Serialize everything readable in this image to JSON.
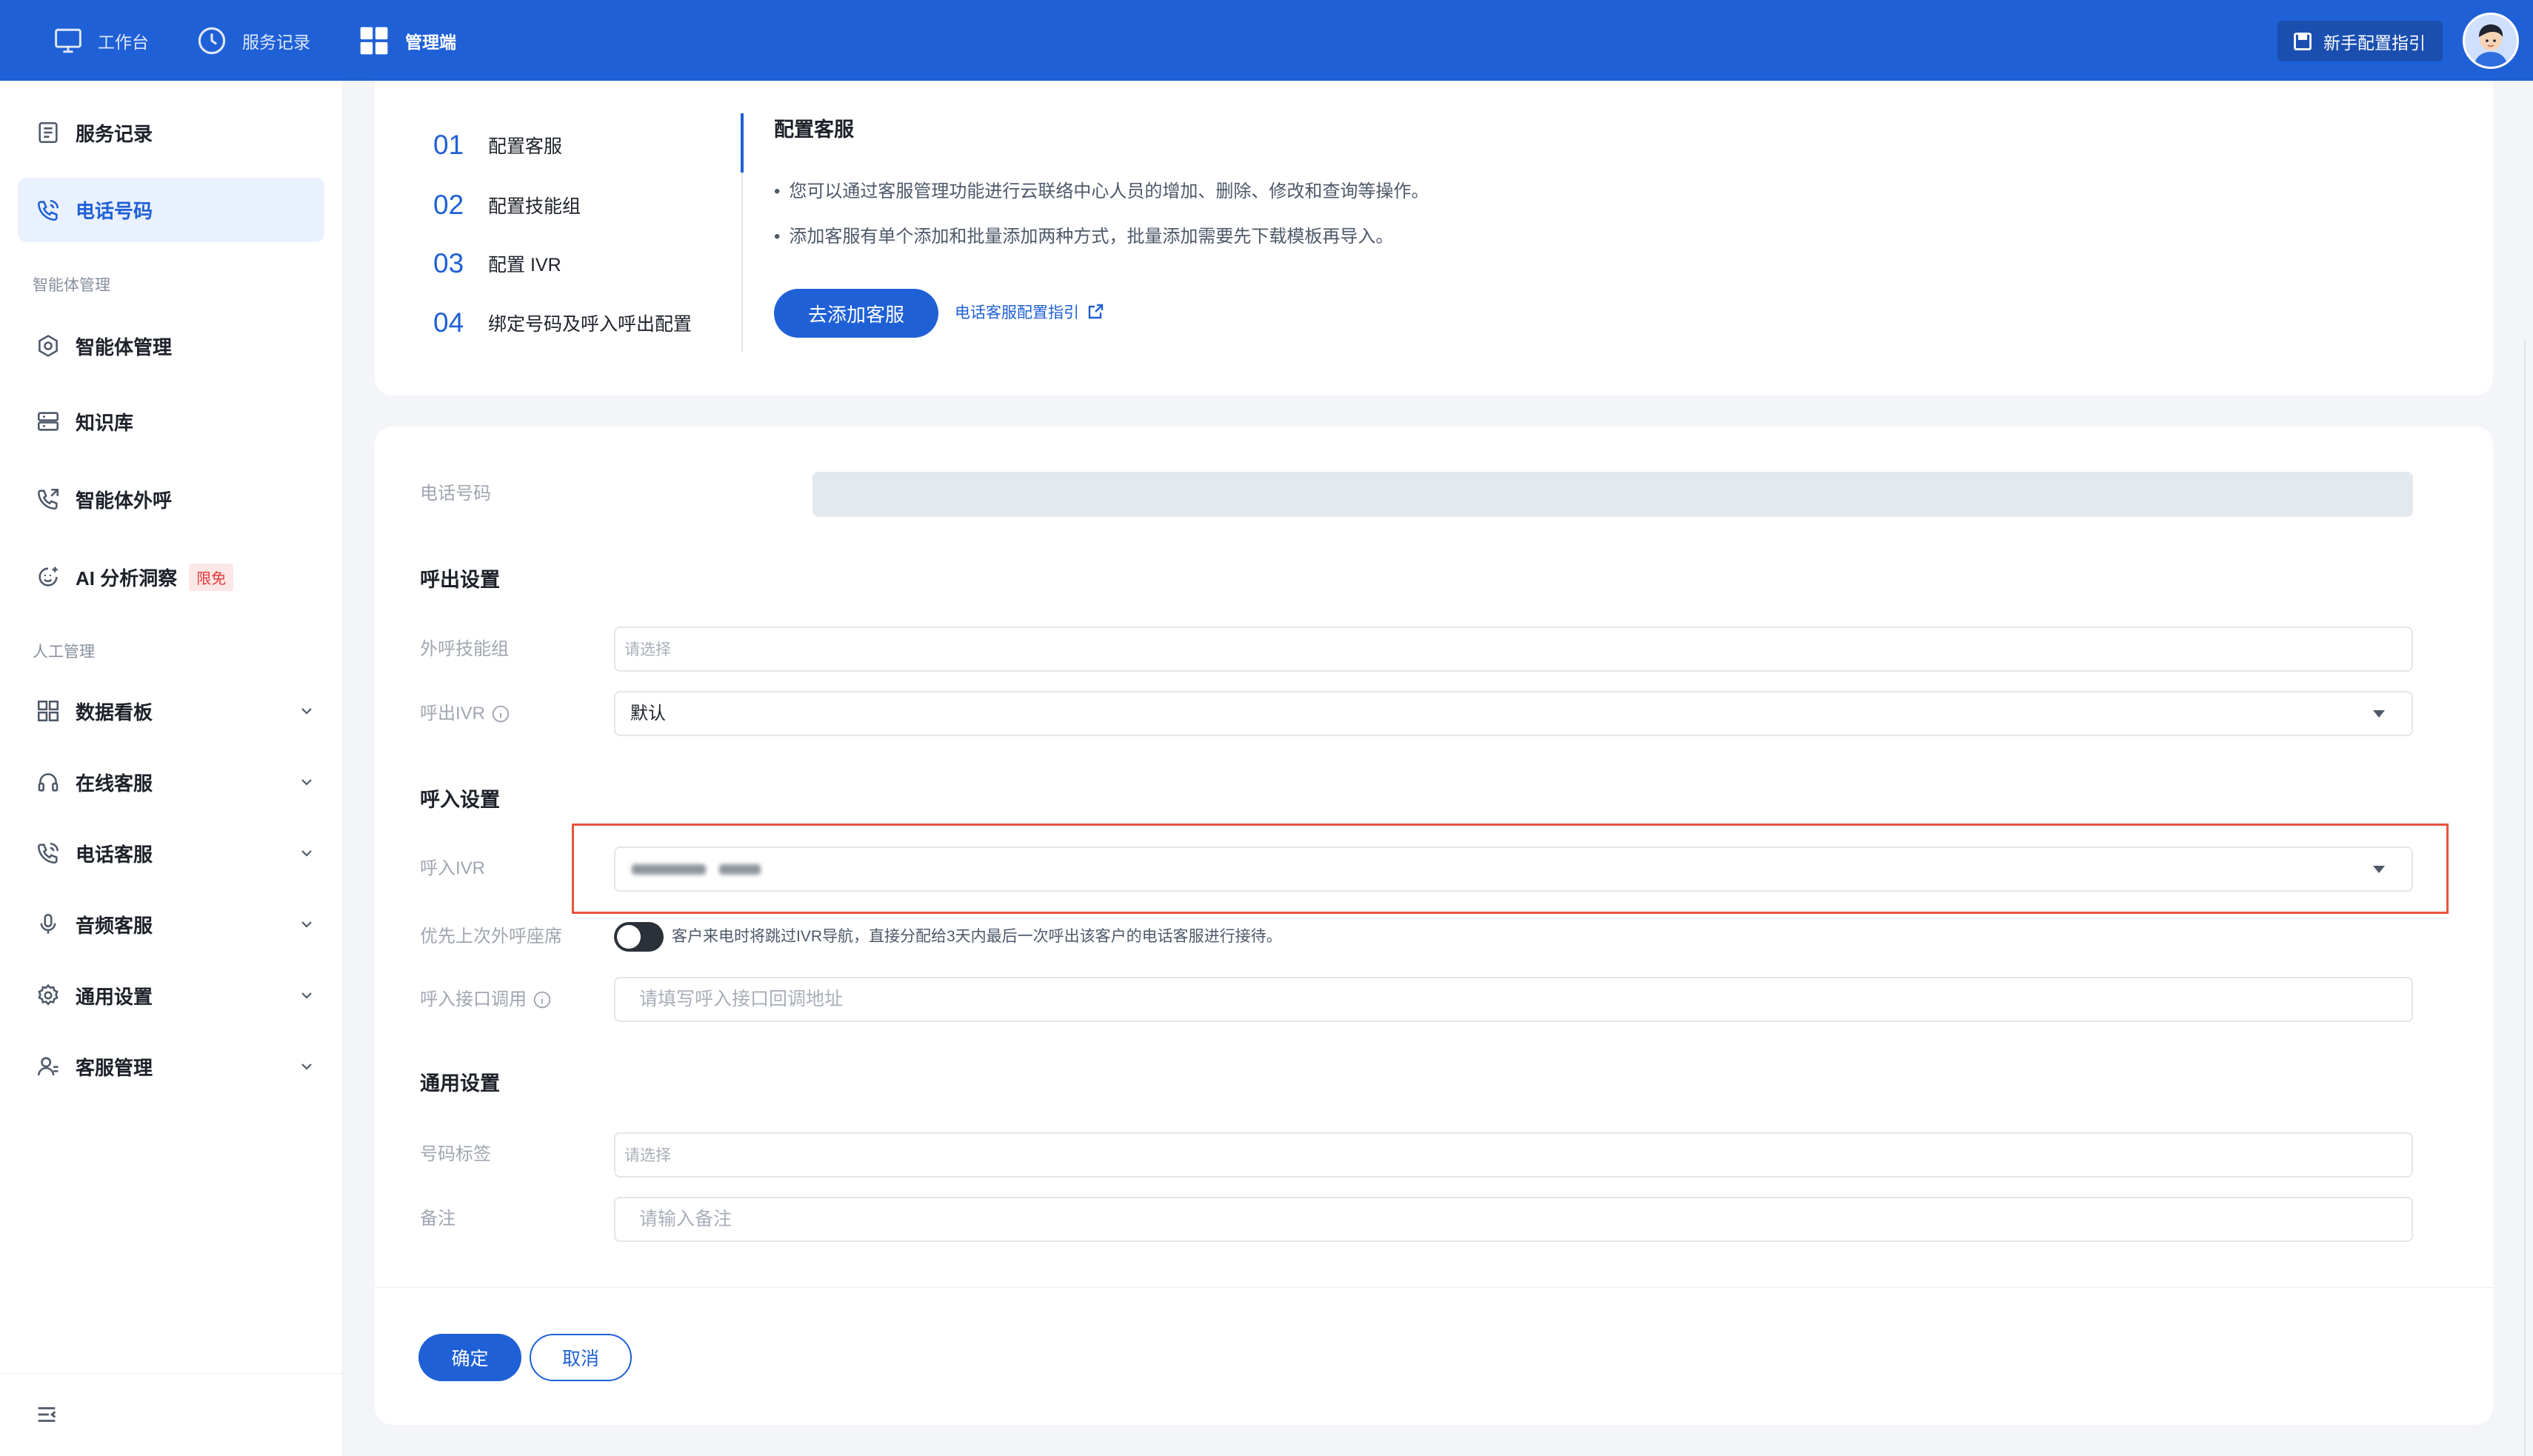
{
  "colors": {
    "primary": "#1f60d6",
    "page_bg": "#f3f5f9",
    "highlight": "#e8543e",
    "badge": "#e5383b"
  },
  "topbar": {
    "nav": [
      {
        "label": "工作台",
        "icon": "monitor-icon"
      },
      {
        "label": "服务记录",
        "icon": "clock-icon"
      },
      {
        "label": "管理端",
        "icon": "grid-icon",
        "active": true
      }
    ],
    "guide_button": "新手配置指引",
    "avatar": "avatar"
  },
  "sidebar": {
    "items": [
      {
        "label": "服务记录",
        "icon": "document-icon"
      },
      {
        "label": "电话号码",
        "icon": "phone-icon",
        "active": true
      }
    ],
    "sections": [
      {
        "title": "智能体管理",
        "items": [
          {
            "label": "智能体管理",
            "icon": "agent-icon"
          },
          {
            "label": "知识库",
            "icon": "database-icon"
          },
          {
            "label": "智能体外呼",
            "icon": "phone-outgoing-icon"
          },
          {
            "label": "AI 分析洞察",
            "icon": "ai-insight-icon",
            "badge": "限免"
          }
        ]
      },
      {
        "title": "人工管理",
        "items": [
          {
            "label": "数据看板",
            "icon": "dashboard-icon"
          },
          {
            "label": "在线客服",
            "icon": "headset-icon"
          },
          {
            "label": "电话客服",
            "icon": "phone-icon"
          },
          {
            "label": "音频客服",
            "icon": "mic-icon"
          },
          {
            "label": "通用设置",
            "icon": "gear-icon"
          },
          {
            "label": "客服管理",
            "icon": "users-icon"
          }
        ]
      }
    ]
  },
  "guide": {
    "steps": [
      {
        "num": "01",
        "label": "配置客服",
        "active": true
      },
      {
        "num": "02",
        "label": "配置技能组"
      },
      {
        "num": "03",
        "label": "配置 IVR"
      },
      {
        "num": "04",
        "label": "绑定号码及呼入呼出配置"
      }
    ],
    "title": "配置客服",
    "bullets": [
      "您可以通过客服管理功能进行云联络中心人员的增加、删除、修改和查询等操作。",
      "添加客服有单个添加和批量添加两种方式，批量添加需要先下载模板再导入。"
    ],
    "primary_button": "去添加客服",
    "link": "电话客服配置指引"
  },
  "form": {
    "phone_number": {
      "label": "电话号码"
    },
    "outbound": {
      "title": "呼出设置",
      "skill_group": {
        "label": "外呼技能组",
        "placeholder": "请选择"
      },
      "ivr": {
        "label": "呼出IVR",
        "value": "默认"
      }
    },
    "inbound": {
      "title": "呼入设置",
      "ivr": {
        "label": "呼入IVR"
      },
      "priority": {
        "label": "优先上次外呼座席",
        "enabled": false,
        "hint": "客户来电时将跳过IVR导航，直接分配给3天内最后一次呼出该客户的电话客服进行接待。"
      },
      "callback": {
        "label": "呼入接口调用",
        "placeholder": "请填写呼入接口回调地址"
      }
    },
    "general": {
      "title": "通用设置",
      "tag": {
        "label": "号码标签",
        "placeholder": "请选择"
      },
      "remark": {
        "label": "备注",
        "placeholder": "请输入备注"
      }
    },
    "confirm": "确定",
    "cancel": "取消"
  }
}
